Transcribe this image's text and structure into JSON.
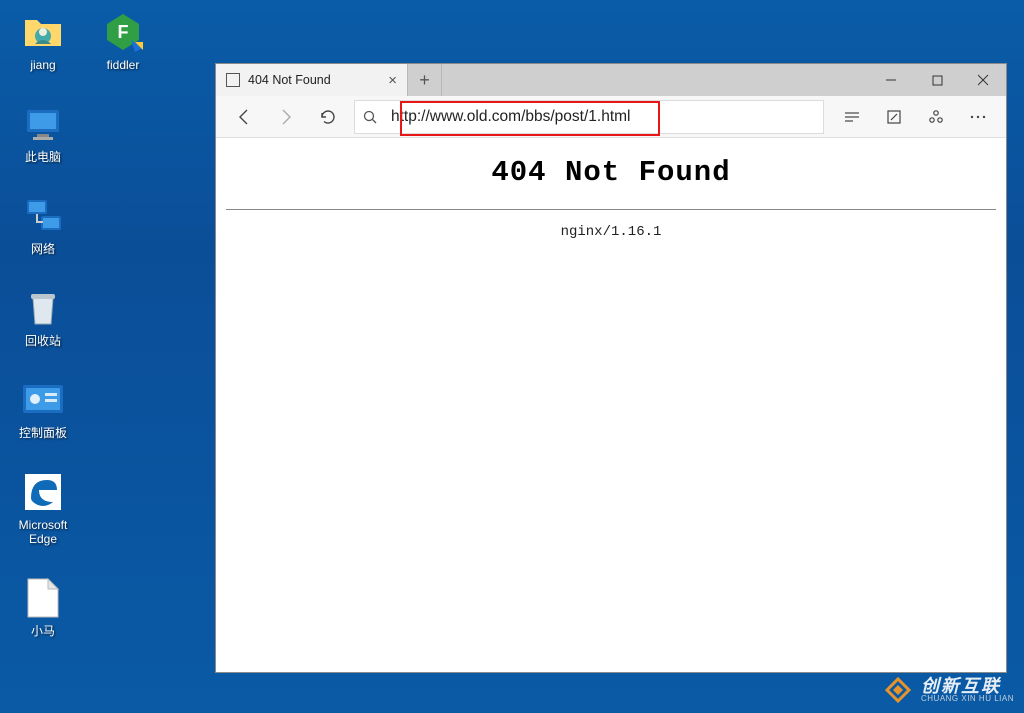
{
  "desktop": {
    "icons_col1": [
      {
        "name": "user-folder",
        "label": "jiang"
      },
      {
        "name": "this-pc",
        "label": "此电脑"
      },
      {
        "name": "network",
        "label": "网络"
      },
      {
        "name": "recycle-bin",
        "label": "回收站"
      },
      {
        "name": "control-panel",
        "label": "控制面板"
      },
      {
        "name": "edge-browser",
        "label": "Microsoft Edge"
      },
      {
        "name": "xiaoma",
        "label": "小马"
      }
    ],
    "icons_col2": [
      {
        "name": "fiddler-app",
        "label": "fiddler"
      }
    ]
  },
  "browser": {
    "tab_title": "404 Not Found",
    "url": "http://www.old.com/bbs/post/1.html",
    "page": {
      "heading": "404 Not Found",
      "server": "nginx/1.16.1"
    }
  },
  "watermark": {
    "cn": "创新互联",
    "en": "CHUANG XIN HU LIAN"
  }
}
